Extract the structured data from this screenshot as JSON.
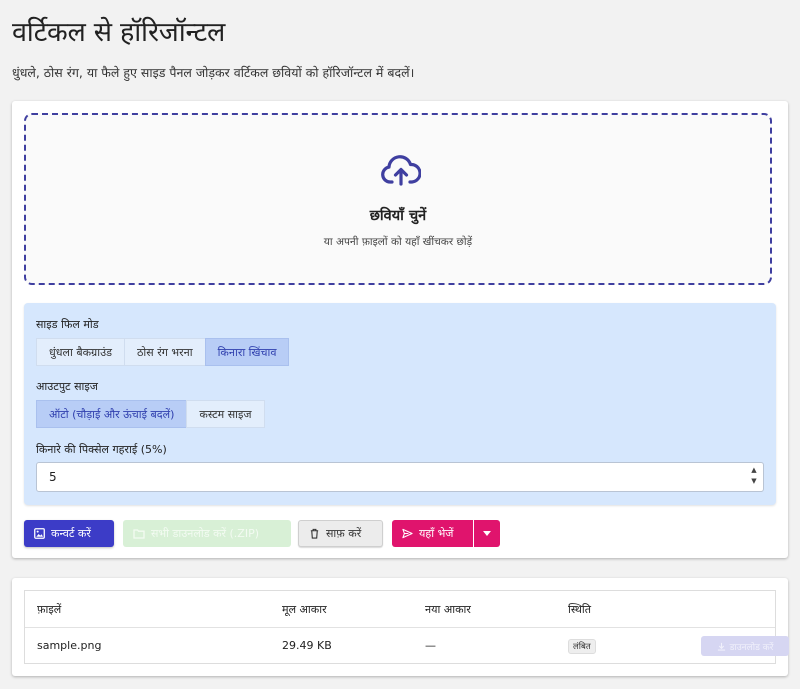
{
  "page": {
    "title": "वर्टिकल से हॉरिजॉन्टल",
    "subtitle": "धुंधले, ठोस रंग, या फैले हुए साइड पैनल जोड़कर वर्टिकल छवियों को हॉरिजॉन्टल में बदलें।"
  },
  "dropzone": {
    "icon": "cloud-upload-icon",
    "title": "छवियाँ चुनें",
    "subtitle": "या अपनी फ़ाइलों को यहाँ खींचकर छोड़ें"
  },
  "settings": {
    "side_fill_label": "साइड फिल मोड",
    "side_fill_options": [
      "धुंधला बैकग्राउंड",
      "ठोस रंग भरना",
      "किनारा खिंचाव"
    ],
    "side_fill_selected": "किनारा खिंचाव",
    "output_size_label": "आउटपुट साइज",
    "output_size_options": [
      "ऑटो (चौड़ाई और ऊंचाई बदलें)",
      "कस्टम साइज"
    ],
    "output_size_selected": "ऑटो (चौड़ाई और ऊंचाई बदलें)",
    "edge_depth_label": "किनारे की पिक्सेल गहराई (5%)",
    "edge_depth_value": "5"
  },
  "actions": {
    "convert": "कन्वर्ट करें",
    "download_all": "सभी डाउनलोड करें (.ZIP)",
    "clear": "साफ़ करें",
    "send_here": "यहाँ भेजें"
  },
  "table": {
    "headers": [
      "फ़ाइलें",
      "मूल आकार",
      "नया आकार",
      "स्थिति"
    ],
    "rows": [
      {
        "file": "sample.png",
        "original_size": "29.49 KB",
        "new_size": "—",
        "status": "लंबित",
        "action": "डाउनलोड करें"
      }
    ]
  },
  "colors": {
    "primary": "#3c3cc7",
    "accent": "#e0146d",
    "settings_bg": "#d6e7fd",
    "dropzone_border": "#3f3fa0"
  }
}
